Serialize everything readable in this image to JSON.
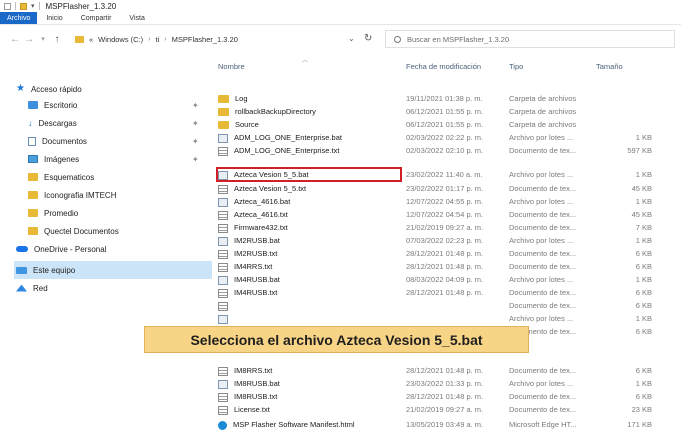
{
  "window": {
    "title": "MSPFlasher_1.3.20"
  },
  "ribbon": {
    "tabs": [
      "Archivo",
      "Inicio",
      "Compartir",
      "Vista"
    ],
    "active": 0
  },
  "address": {
    "path": [
      "Windows (C:)",
      "ti",
      "MSPFlasher_1.3.20"
    ],
    "overflow": "«",
    "search_placeholder": "Buscar en MSPFlasher_1.3.20"
  },
  "columns": {
    "name": "Nombre",
    "date": "Fecha de modificación",
    "type": "Tipo",
    "size": "Tamaño"
  },
  "sidebar": {
    "items": [
      {
        "label": "Acceso rápido",
        "icon": "star-icon",
        "pinned": false
      },
      {
        "label": "Escritorio",
        "icon": "desktop-icon",
        "pinned": true
      },
      {
        "label": "Descargas",
        "icon": "download-icon",
        "pinned": true
      },
      {
        "label": "Documentos",
        "icon": "documents-icon",
        "pinned": true
      },
      {
        "label": "Imágenes",
        "icon": "images-icon",
        "pinned": true
      },
      {
        "label": "Esquematicos",
        "icon": "folder-icon",
        "pinned": false
      },
      {
        "label": "Iconografia IMTECH",
        "icon": "folder-icon",
        "pinned": false
      },
      {
        "label": "Promedio",
        "icon": "folder-icon",
        "pinned": false
      },
      {
        "label": "Quectel Documentos",
        "icon": "folder-icon",
        "pinned": false
      },
      {
        "label": "OneDrive - Personal",
        "icon": "onedrive-icon",
        "pinned": false
      },
      {
        "label": "Este equipo",
        "icon": "computer-icon",
        "pinned": false,
        "selected": true
      },
      {
        "label": "Red",
        "icon": "network-icon",
        "pinned": false
      }
    ]
  },
  "files": [
    {
      "name": "Log",
      "date": "19/11/2021 01:38 p. m.",
      "type": "Carpeta de archivos",
      "size": "",
      "kind": "folder"
    },
    {
      "name": "rollbackBackupDirectory",
      "date": "06/12/2021 01:55 p. m.",
      "type": "Carpeta de archivos",
      "size": "",
      "kind": "folder"
    },
    {
      "name": "Source",
      "date": "06/12/2021 01:55 p. m.",
      "type": "Carpeta de archivos",
      "size": "",
      "kind": "folder"
    },
    {
      "name": "ADM_LOG_ONE_Enterprise.bat",
      "date": "02/03/2022 02:22 p. m.",
      "type": "Archivo por lotes ...",
      "size": "1 KB",
      "kind": "bat"
    },
    {
      "name": "ADM_LOG_ONE_Enterprise.txt",
      "date": "02/03/2022 02:10 p. m.",
      "type": "Documento de tex...",
      "size": "597 KB",
      "kind": "txt"
    },
    {
      "name": "Azteca Vesion 5_5.bat",
      "date": "23/02/2022 11:40 a. m.",
      "type": "Archivo por lotes ...",
      "size": "1 KB",
      "kind": "bat"
    },
    {
      "name": "Azteca Vesion 5_5.txt",
      "date": "23/02/2022 01:17 p. m.",
      "type": "Documento de tex...",
      "size": "45 KB",
      "kind": "txt"
    },
    {
      "name": "Azteca_4616.bat",
      "date": "12/07/2022 04:55 p. m.",
      "type": "Archivo por lotes ...",
      "size": "1 KB",
      "kind": "bat"
    },
    {
      "name": "Azteca_4616.txt",
      "date": "12/07/2022 04:54 p. m.",
      "type": "Documento de tex...",
      "size": "45 KB",
      "kind": "txt"
    },
    {
      "name": "Firmware432.txt",
      "date": "21/02/2019 09:27 a. m.",
      "type": "Documento de tex...",
      "size": "7 KB",
      "kind": "txt"
    },
    {
      "name": "IM2RUSB.bat",
      "date": "07/03/2022 02:23 p. m.",
      "type": "Archivo por lotes ...",
      "size": "1 KB",
      "kind": "bat"
    },
    {
      "name": "IM2RUSB.txt",
      "date": "28/12/2021 01:48 p. m.",
      "type": "Documento de tex...",
      "size": "6 KB",
      "kind": "txt"
    },
    {
      "name": "IM4RRS.txt",
      "date": "28/12/2021 01:48 p. m.",
      "type": "Documento de tex...",
      "size": "6 KB",
      "kind": "txt"
    },
    {
      "name": "IM4RUSB.bat",
      "date": "08/03/2022 04:09 p. m.",
      "type": "Archivo por lotes ...",
      "size": "1 KB",
      "kind": "bat"
    },
    {
      "name": "IM4RUSB.txt",
      "date": "28/12/2021 01:48 p. m.",
      "type": "Documento de tex...",
      "size": "6 KB",
      "kind": "txt"
    },
    {
      "name": "",
      "date": "",
      "type": "Documento de tex...",
      "size": "6 KB",
      "kind": "txt"
    },
    {
      "name": "",
      "date": "",
      "type": "Archivo por lotes ...",
      "size": "1 KB",
      "kind": "bat"
    },
    {
      "name": "",
      "date": "",
      "type": "Documento de tex...",
      "size": "6 KB",
      "kind": "txt"
    },
    {
      "name": "IM8RRS.txt",
      "date": "28/12/2021 01:48 p. m.",
      "type": "Documento de tex...",
      "size": "6 KB",
      "kind": "txt"
    },
    {
      "name": "IM8RUSB.bat",
      "date": "23/03/2022 01:33 p. m.",
      "type": "Archivo por lotes ...",
      "size": "1 KB",
      "kind": "bat"
    },
    {
      "name": "IM8RUSB.txt",
      "date": "28/12/2021 01:48 p. m.",
      "type": "Documento de tex...",
      "size": "6 KB",
      "kind": "txt"
    },
    {
      "name": "License.txt",
      "date": "21/02/2019 09:27 a. m.",
      "type": "Documento de tex...",
      "size": "23 KB",
      "kind": "txt"
    },
    {
      "name": "MSP Flasher Software Manifest.html",
      "date": "13/05/2019 03:49 a. m.",
      "type": "Microsoft Edge HT...",
      "size": "171 KB",
      "kind": "edge"
    }
  ],
  "highlighted_file": "Azteca Vesion 5_5.bat",
  "callout": {
    "text": "Selecciona el archivo Azteca Vesion 5_5.bat"
  }
}
